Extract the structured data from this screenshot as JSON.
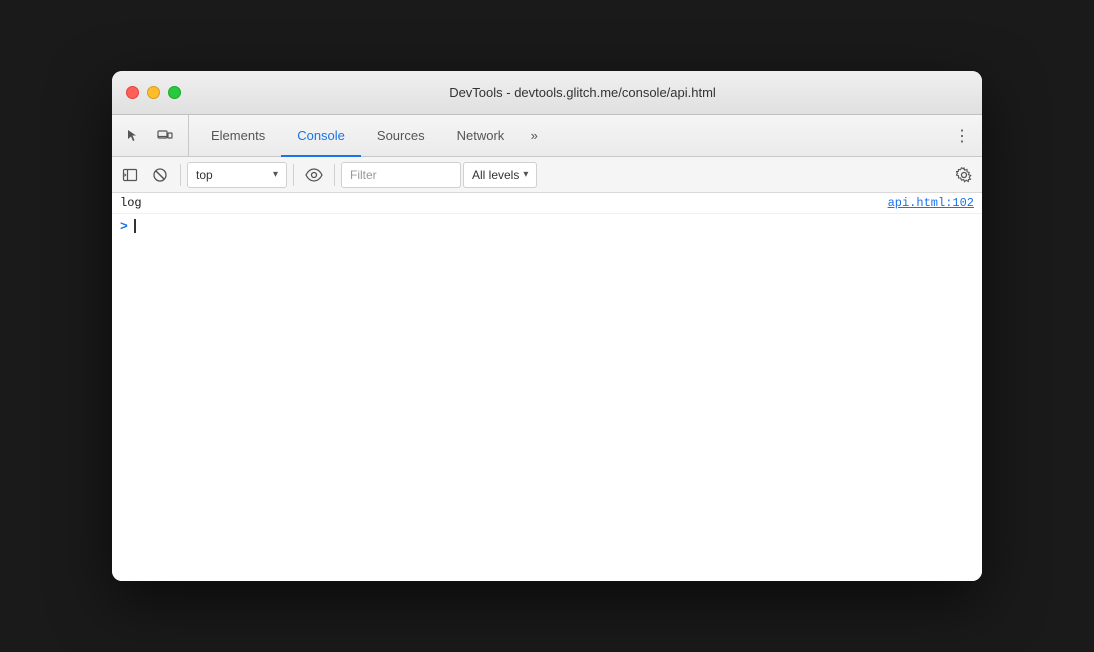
{
  "window": {
    "title": "DevTools - devtools.glitch.me/console/api.html"
  },
  "tabs": {
    "items": [
      {
        "id": "elements",
        "label": "Elements",
        "active": false
      },
      {
        "id": "console",
        "label": "Console",
        "active": true
      },
      {
        "id": "sources",
        "label": "Sources",
        "active": false
      },
      {
        "id": "network",
        "label": "Network",
        "active": false
      }
    ],
    "more_label": "»",
    "menu_label": "⋮"
  },
  "console_toolbar": {
    "context": "top",
    "context_arrow": "▾",
    "filter_placeholder": "Filter",
    "levels_label": "All levels",
    "levels_arrow": "▾"
  },
  "console_entries": [
    {
      "text": "log",
      "source": "api.html:102"
    }
  ],
  "console_input": {
    "prompt": ">"
  },
  "colors": {
    "active_tab": "#1a73e8",
    "link_blue": "#1a73e8"
  }
}
